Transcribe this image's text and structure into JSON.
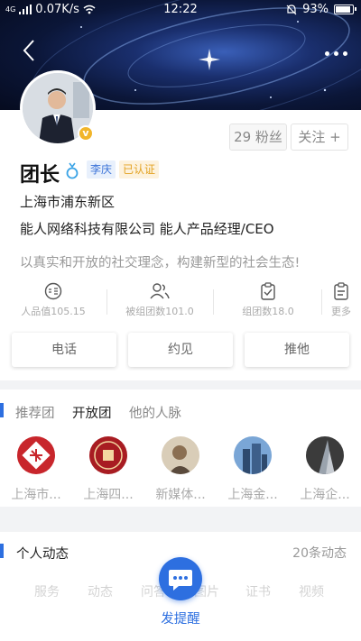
{
  "status_bar": {
    "network": "4G",
    "speed": "0.07K/s",
    "time": "12:22",
    "battery": "93%",
    "battery_level": 0.93
  },
  "profile": {
    "name": "团长",
    "city_tag": "李庆",
    "cert_tag": "已认证",
    "location": "上海市浦东新区",
    "company": "能人网络科技有限公司  能人产品经理/CEO",
    "motto": "以真实和开放的社交理念，构建新型的社会生态!",
    "fans_label": "29 粉丝",
    "follow_label": "关注 +",
    "verify_badge": "v"
  },
  "stats": [
    {
      "label": "人品值105.15",
      "icon": "people-value-icon"
    },
    {
      "label": "被组团数101.0",
      "icon": "group-users-icon"
    },
    {
      "label": "组团数18.0",
      "icon": "clipboard-check-icon"
    },
    {
      "label": "更多",
      "icon": "clipboard-more-icon"
    }
  ],
  "actions": {
    "call": "电话",
    "meet": "约见",
    "recommend": "推他"
  },
  "groups_section": {
    "tabs": [
      "推荐团",
      "开放团",
      "他的人脉"
    ],
    "active_tab": "开放团",
    "items": [
      {
        "label": "上海市..."
      },
      {
        "label": "上海四..."
      },
      {
        "label": "新媒体..."
      },
      {
        "label": "上海金..."
      },
      {
        "label": "上海企..."
      }
    ]
  },
  "dynamics": {
    "title": "个人动态",
    "count": "20条动态",
    "subtabs": [
      "服务",
      "动态",
      "问答",
      "图片",
      "证书",
      "视频"
    ]
  },
  "fab": {
    "label": "发提醒"
  },
  "colors": {
    "accent": "#2d6fe0",
    "cert": "#e3a221",
    "hero_dark": "#0b1638"
  }
}
